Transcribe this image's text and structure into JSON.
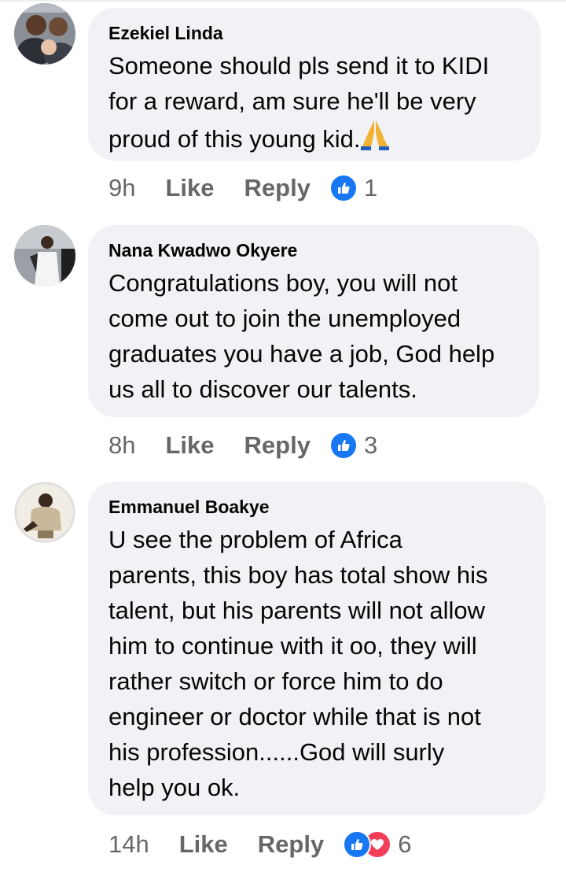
{
  "comments": [
    {
      "author": "Ezekiel Linda",
      "text": "Someone should pls send it to KIDI\nfor a reward, am sure he'll be very\nproud of this young kid.",
      "emoji": "folded-hands",
      "time": "9h",
      "like_label": "Like",
      "reply_label": "Reply",
      "reaction_count": "1",
      "reactions": [
        "like"
      ]
    },
    {
      "author": "Nana Kwadwo Okyere",
      "text": "Congratulations boy, you will not\ncome out to join the unemployed\ngraduates you have a job, God help\nus all to discover our talents.",
      "time": "8h",
      "like_label": "Like",
      "reply_label": "Reply",
      "reaction_count": "3",
      "reactions": [
        "like"
      ]
    },
    {
      "author": "Emmanuel Boakye",
      "text": "U see the problem of Africa\nparents, this boy has total show his\ntalent, but his parents will not allow\nhim to continue with it oo, they will\nrather switch or force him to do\nengineer or doctor while that is not\nhis profession......God will surly\nhelp you ok.",
      "time": "14h",
      "like_label": "Like",
      "reply_label": "Reply",
      "reaction_count": "6",
      "reactions": [
        "like",
        "love"
      ]
    }
  ],
  "colors": {
    "bubble": "#f0f2f5",
    "meta_text": "#65676b",
    "like_blue": "#1877f2",
    "love_red": "#f33e58"
  }
}
